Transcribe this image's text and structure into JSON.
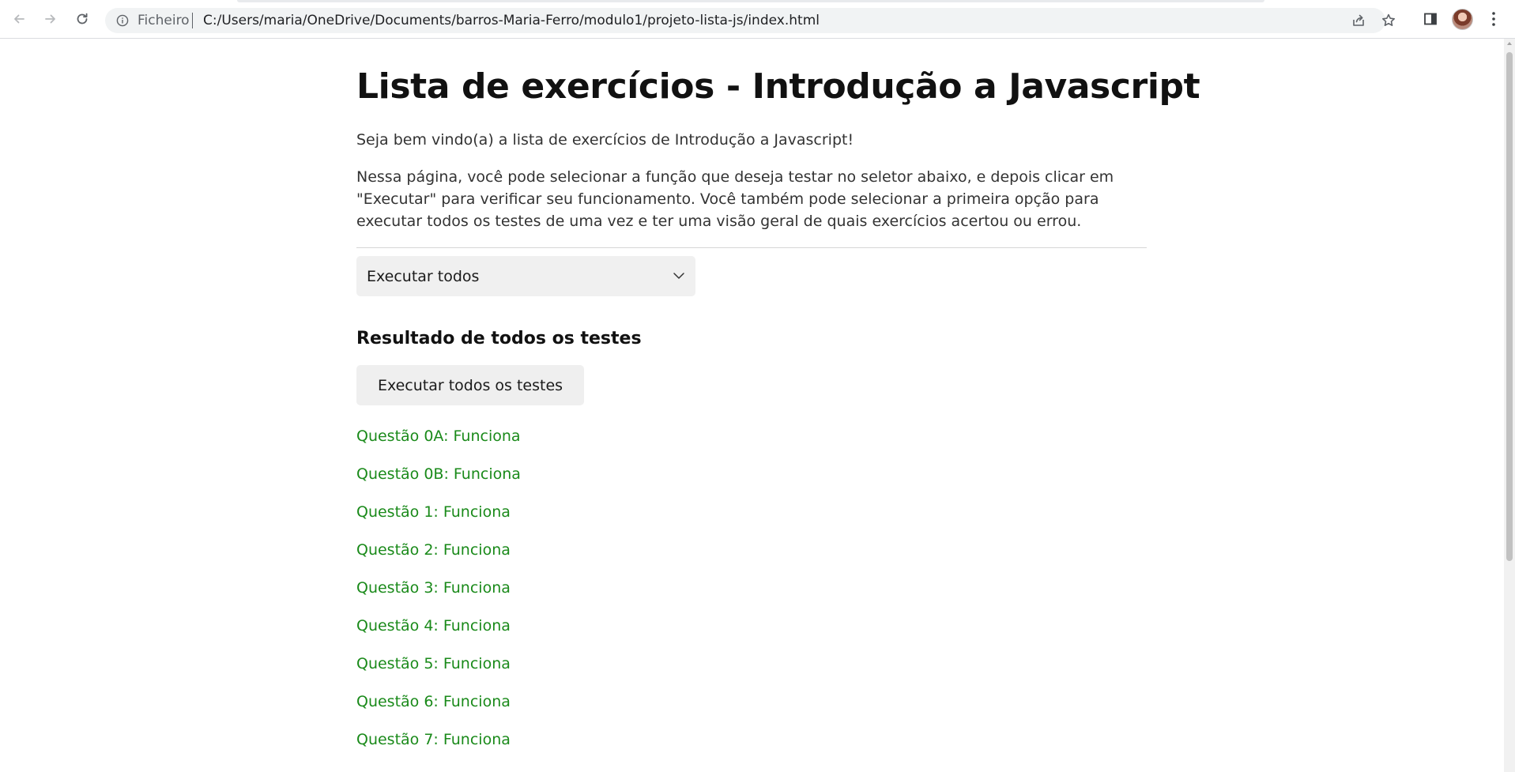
{
  "browser": {
    "scheme_label": "Ficheiro",
    "url": "C:/Users/maria/OneDrive/Documents/barros-Maria-Ferro/modulo1/projeto-lista-js/index.html",
    "icons": [
      "back-arrow-icon",
      "forward-arrow-icon",
      "reload-icon",
      "info-icon",
      "share-icon",
      "star-icon",
      "side-panel-icon",
      "avatar",
      "more-vertical-icon"
    ]
  },
  "page": {
    "title": "Lista de exercícios - Introdução a Javascript",
    "intro": "Seja bem vindo(a) a lista de exercícios de Introdução a Javascript!",
    "description": "Nessa página, você pode selecionar a função que deseja testar no seletor abaixo, e depois clicar em \"Executar\" para verificar seu funcionamento. Você também pode selecionar a primeira opção para executar todos os testes de uma vez e ter uma visão geral de quais exercícios acertou ou errou.",
    "select": {
      "selected": "Executar todos"
    },
    "results_heading": "Resultado de todos os testes",
    "run_button": "Executar todos os testes",
    "results": [
      "Questão 0A: Funciona",
      "Questão 0B: Funciona",
      "Questão 1: Funciona",
      "Questão 2: Funciona",
      "Questão 3: Funciona",
      "Questão 4: Funciona",
      "Questão 5: Funciona",
      "Questão 6: Funciona",
      "Questão 7: Funciona"
    ]
  },
  "colors": {
    "success": "#1a8a1a",
    "omnibox": "#f1f3f4",
    "control_bg": "#f0f0f0"
  }
}
